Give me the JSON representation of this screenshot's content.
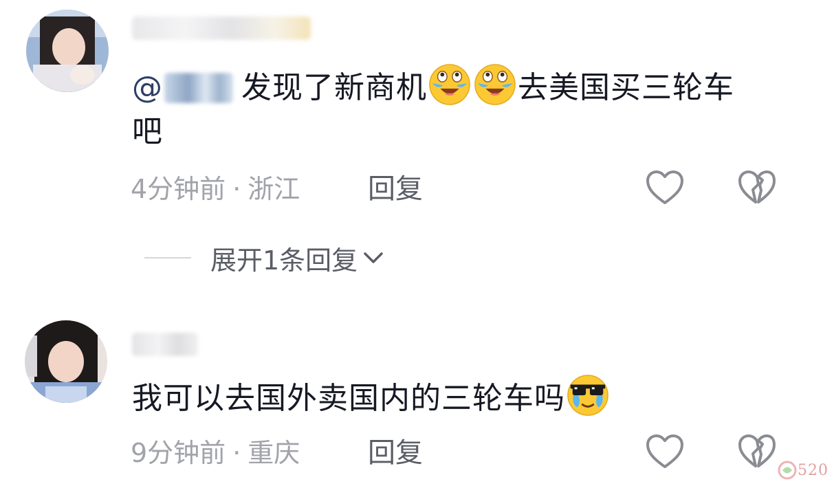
{
  "comments": [
    {
      "username_hidden": true,
      "text": {
        "mention_prefix": "@",
        "line1_before": "发现了新商机",
        "emoji1": "laughing-crying-emoji",
        "emoji2": "laughing-crying-emoji",
        "line1_after": "去美国买三轮车",
        "line2": "吧"
      },
      "time": "4分钟前",
      "separator": "·",
      "location": "浙江",
      "reply_label": "回复",
      "expand_label": "展开1条回复"
    },
    {
      "username_hidden": true,
      "text": {
        "body": "我可以去国外卖国内的三轮车吗",
        "emoji": "cool-crying-emoji"
      },
      "time": "9分钟前",
      "separator": "·",
      "location": "重庆",
      "reply_label": "回复"
    }
  ],
  "icons": {
    "like": "heart-outline-icon",
    "dislike": "broken-heart-icon",
    "expand": "chevron-down-icon"
  },
  "colors": {
    "text": "#161823",
    "meta": "#a1a3a9",
    "reply": "#5a5d66",
    "mention": "#2d3f66",
    "icon": "#8a8c92"
  },
  "watermark": "520"
}
